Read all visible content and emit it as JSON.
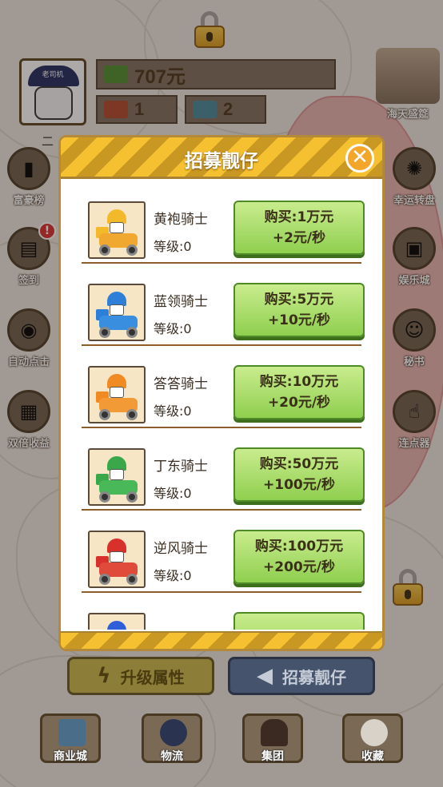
{
  "header": {
    "avatar_cap_text": "老司机",
    "money": "707元",
    "trucks": "1",
    "maps": "2",
    "partial_label": "二"
  },
  "top_right": {
    "label": "海天盛筵"
  },
  "left_buttons": [
    {
      "label": "富豪榜",
      "icon": "trophy-icon"
    },
    {
      "label": "签到",
      "icon": "calendar-icon",
      "badge": "!"
    },
    {
      "label": "自动点击",
      "icon": "robot-icon"
    },
    {
      "label": "双倍收益",
      "icon": "cash-icon"
    }
  ],
  "right_buttons": [
    {
      "label": "幸运转盘",
      "icon": "wheel-icon"
    },
    {
      "label": "娱乐城",
      "icon": "gameboy-icon"
    },
    {
      "label": "秘书",
      "icon": "secretary-icon"
    },
    {
      "label": "连点器",
      "icon": "tap-icon"
    }
  ],
  "modal": {
    "title": "招募靓仔",
    "close": "✕",
    "riders": [
      {
        "name": "黄袍骑士",
        "level": "等级:0",
        "price": "购买:1万元",
        "income": "+2元/秒",
        "helmet": "#f2b92a",
        "bike": "#f0a830"
      },
      {
        "name": "蓝领骑士",
        "level": "等级:0",
        "price": "购买:5万元",
        "income": "+10元/秒",
        "helmet": "#2e7fd8",
        "bike": "#3a8ee0"
      },
      {
        "name": "答答骑士",
        "level": "等级:0",
        "price": "购买:10万元",
        "income": "+20元/秒",
        "helmet": "#f08a22",
        "bike": "#f29a36"
      },
      {
        "name": "丁东骑士",
        "level": "等级:0",
        "price": "购买:50万元",
        "income": "+100元/秒",
        "helmet": "#3aa84a",
        "bike": "#48b858"
      },
      {
        "name": "逆风骑士",
        "level": "等级:0",
        "price": "购买:100万元",
        "income": "+200元/秒",
        "helmet": "#d8302a",
        "bike": "#e04a3a"
      },
      {
        "name": "",
        "level": "",
        "price": "",
        "income": "",
        "helmet": "#2e5fd8",
        "bike": "#3a6ee0"
      }
    ]
  },
  "bottom_buttons": {
    "upgrade": "升级属性",
    "recruit": "招募靓仔"
  },
  "dock": [
    {
      "label": "商业城",
      "icon": "building-icon"
    },
    {
      "label": "物流",
      "icon": "globe-icon"
    },
    {
      "label": "集团",
      "icon": "boss-icon"
    },
    {
      "label": "收藏",
      "icon": "crystal-ball-icon"
    }
  ]
}
